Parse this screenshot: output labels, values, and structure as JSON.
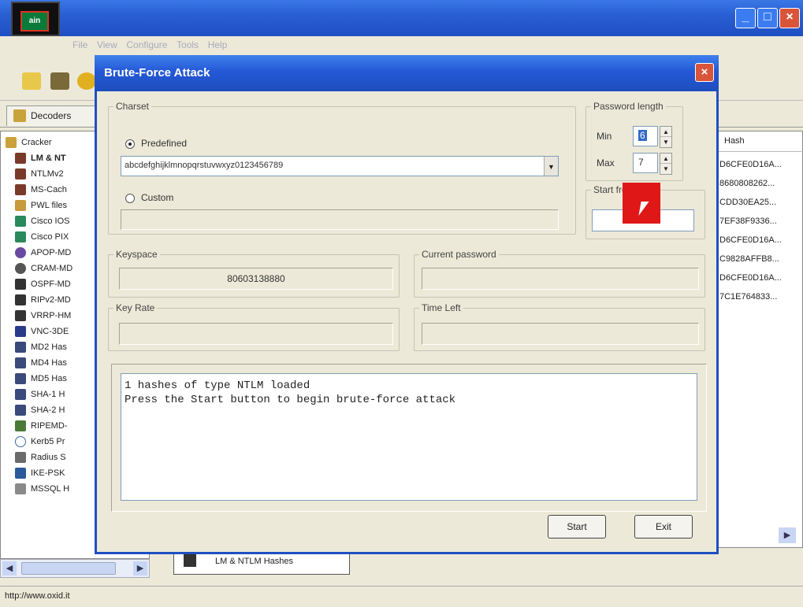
{
  "main": {
    "menu": [
      "File",
      "View",
      "Configure",
      "Tools",
      "Help"
    ],
    "tab_decoders": "Decoders",
    "tree": {
      "root": "Cracker",
      "items": [
        "LM & NT",
        "NTLMv2",
        "MS-Cach",
        "PWL files",
        "Cisco IOS",
        "Cisco PIX",
        "APOP-MD",
        "CRAM-MD",
        "OSPF-MD",
        "RIPv2-MD",
        "VRRP-HM",
        "VNC-3DE",
        "MD2 Has",
        "MD4 Has",
        "MD5 Has",
        "SHA-1 H",
        "SHA-2 H",
        "RIPEMD-",
        "Kerb5 Pr",
        "Radius S",
        "IKE-PSK",
        "MSSQL H"
      ]
    },
    "hash_header": "Hash",
    "hashes": [
      "D6CFE0D16A...",
      "8680808262...",
      "CDD30EA25...",
      "7EF38F9336...",
      "D6CFE0D16A...",
      "C9828AFFB8...",
      "D6CFE0D16A...",
      "7C1E764833..."
    ],
    "bottom_tab": "LM & NTLM Hashes",
    "status_url": "http://www.oxid.it"
  },
  "dialog": {
    "title": "Brute-Force Attack",
    "charset_legend": "Charset",
    "predefined_label": "Predefined",
    "charset_value": "abcdefghijklmnopqrstuvwxyz0123456789",
    "custom_label": "Custom",
    "custom_value": "",
    "password_length_legend": "Password length",
    "min_label": "Min",
    "min_value": "6",
    "max_label": "Max",
    "max_value": "7",
    "start_from_legend": "Start from",
    "start_from_value": "",
    "keyspace_legend": "Keyspace",
    "keyspace_value": "80603138880",
    "current_password_legend": "Current password",
    "current_password_value": "",
    "key_rate_legend": "Key Rate",
    "key_rate_value": "",
    "time_left_legend": "Time Left",
    "time_left_value": "",
    "log": "1 hashes of type NTLM loaded\nPress the Start button to begin brute-force attack",
    "start_button": "Start",
    "exit_button": "Exit"
  }
}
